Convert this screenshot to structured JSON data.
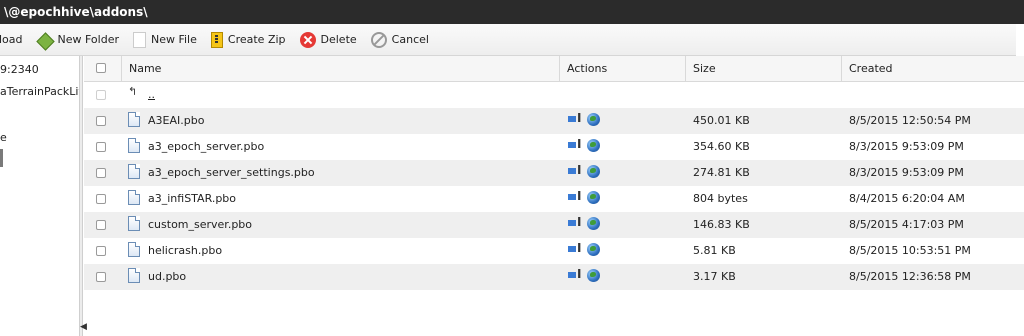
{
  "title": "\\@epochhive\\addons\\",
  "toolbar": {
    "upload_label": "pload",
    "new_folder_label": "New Folder",
    "new_file_label": "New File",
    "create_zip_label": "Create Zip",
    "delete_label": "Delete",
    "cancel_label": "Cancel"
  },
  "leftpane": {
    "line1": "9:2340",
    "line2": "aTerrainPackLit",
    "line3": "e"
  },
  "grid": {
    "columns": [
      "Name",
      "Actions",
      "Size",
      "Created"
    ],
    "parent_link": "..",
    "rows": [
      {
        "name": "A3EAI.pbo",
        "size": "450.01 KB",
        "created": "8/5/2015 12:50:54 PM"
      },
      {
        "name": "a3_epoch_server.pbo",
        "size": "354.60 KB",
        "created": "8/3/2015 9:53:09 PM"
      },
      {
        "name": "a3_epoch_server_settings.pbo",
        "size": "274.81 KB",
        "created": "8/3/2015 9:53:09 PM"
      },
      {
        "name": "a3_infiSTAR.pbo",
        "size": "804 bytes",
        "created": "8/4/2015 6:20:04 AM"
      },
      {
        "name": "custom_server.pbo",
        "size": "146.83 KB",
        "created": "8/5/2015 4:17:03 PM"
      },
      {
        "name": "helicrash.pbo",
        "size": "5.81 KB",
        "created": "8/5/2015 10:53:51 PM"
      },
      {
        "name": "ud.pbo",
        "size": "3.17 KB",
        "created": "8/5/2015 12:36:58 PM"
      }
    ]
  }
}
